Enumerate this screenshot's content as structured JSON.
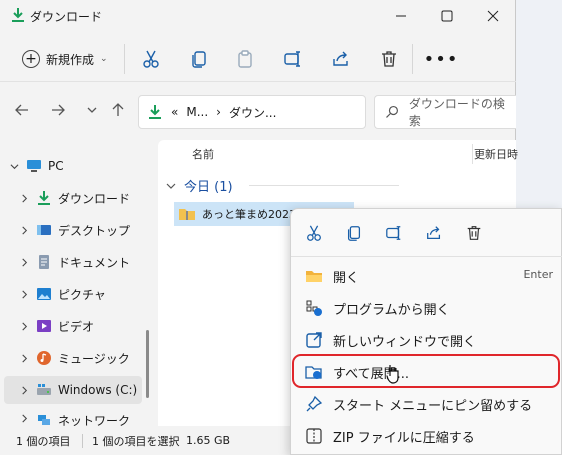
{
  "window": {
    "title": "ダウンロード"
  },
  "commandbar": {
    "new_label": "新規作成",
    "more_label": "•••"
  },
  "address": {
    "crumbs": [
      "«",
      "M...",
      "›",
      "ダウン..."
    ],
    "search_placeholder": "ダウンロードの検索"
  },
  "navpane": {
    "items": [
      {
        "label": "PC",
        "icon": "pc-icon"
      },
      {
        "label": "ダウンロード",
        "icon": "download-icon"
      },
      {
        "label": "デスクトップ",
        "icon": "desktop-icon"
      },
      {
        "label": "ドキュメント",
        "icon": "document-icon"
      },
      {
        "label": "ピクチャ",
        "icon": "picture-icon"
      },
      {
        "label": "ビデオ",
        "icon": "video-icon"
      },
      {
        "label": "ミュージック",
        "icon": "music-icon"
      },
      {
        "label": "Windows (C:)",
        "icon": "drive-icon"
      },
      {
        "label": "ネットワーク",
        "icon": "network-icon"
      }
    ]
  },
  "content": {
    "columns": {
      "name": "名前",
      "modified": "更新日時"
    },
    "group": {
      "label": "今日 (1)"
    },
    "file": {
      "name": "あっと筆まめ2023.zip"
    }
  },
  "statusbar": {
    "count": "1 個の項目",
    "selected": "1 個の項目を選択",
    "size": "1.65 GB"
  },
  "context_menu": {
    "items": [
      {
        "label": "開く",
        "shortcut": "Enter",
        "icon": "folder-open-icon"
      },
      {
        "label": "プログラムから開く",
        "icon": "open-with-icon"
      },
      {
        "label": "新しいウィンドウで開く",
        "icon": "new-window-icon"
      },
      {
        "label": "すべて展開...",
        "icon": "extract-icon"
      },
      {
        "label": "スタート メニューにピン留めする",
        "icon": "pin-icon"
      },
      {
        "label": "ZIP ファイルに圧縮する",
        "icon": "zip-icon"
      }
    ]
  },
  "colors": {
    "accent": "#0f6cbd",
    "selection": "#cce4f7",
    "highlight_ring": "#e0262b",
    "download_green": "#1a9e5a"
  }
}
